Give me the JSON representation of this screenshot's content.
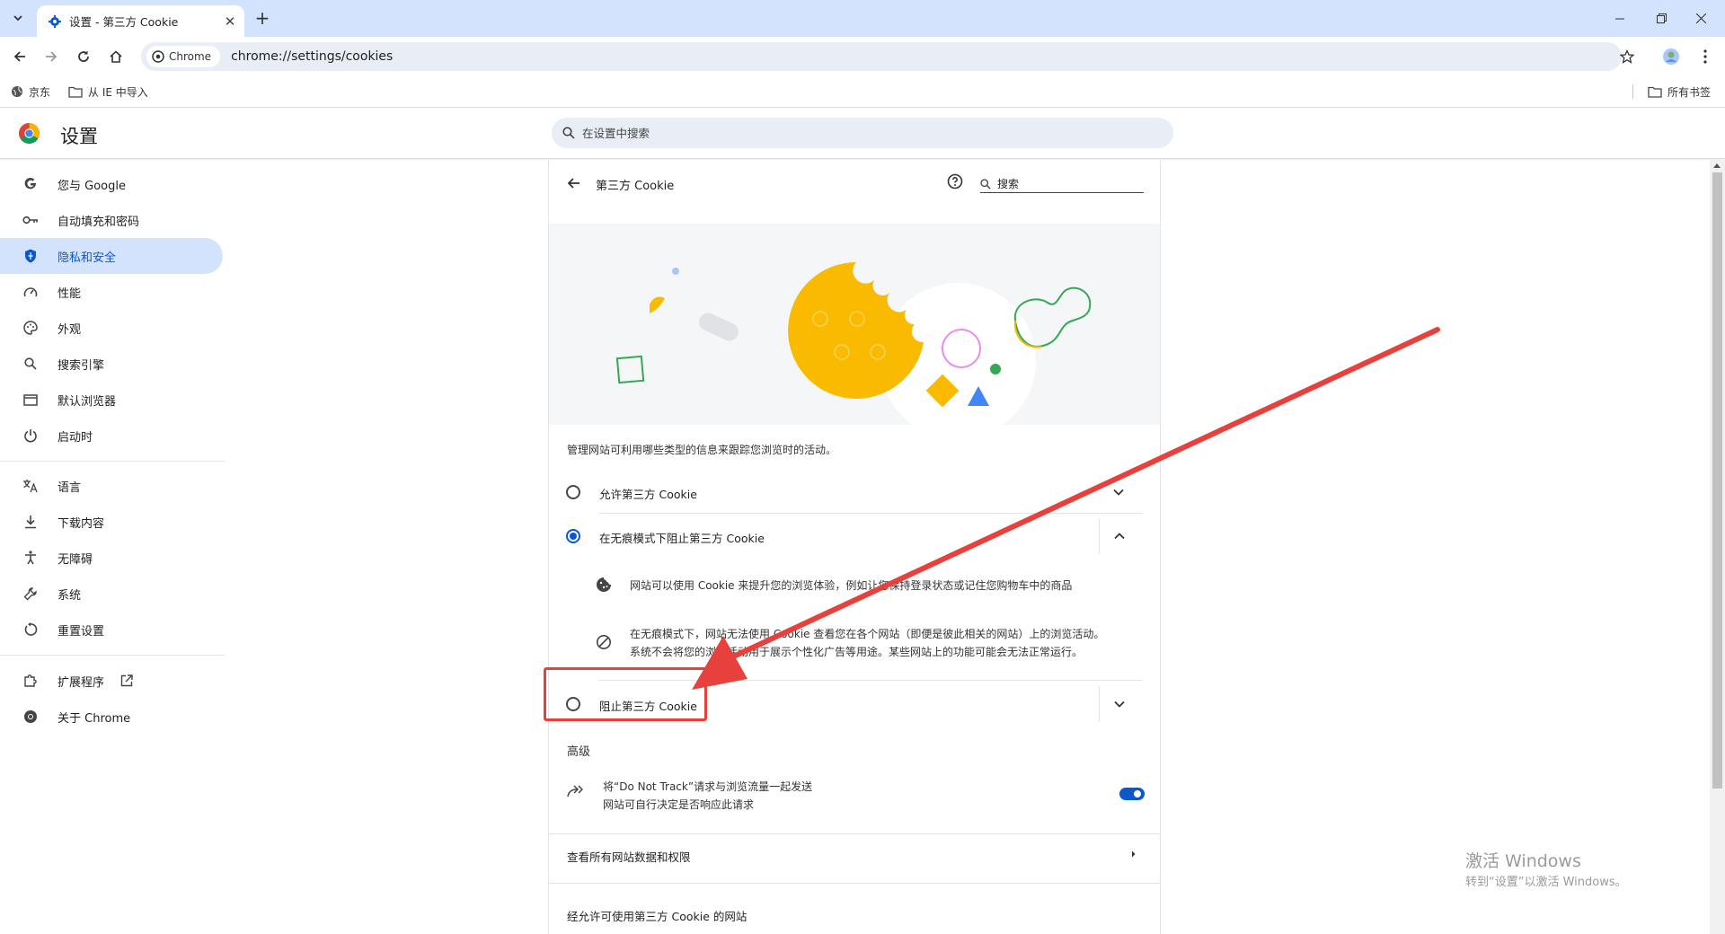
{
  "browser": {
    "tab_title": "设置 - 第三方 Cookie",
    "chip_label": "Chrome",
    "url": "chrome://settings/cookies",
    "bookmarks": [
      "京东",
      "从 IE 中导入"
    ],
    "all_bookmarks": "所有书签"
  },
  "header": {
    "title": "设置",
    "search_placeholder": "在设置中搜索"
  },
  "sidebar": {
    "items": [
      {
        "label": "您与 Google",
        "icon": "google-icon"
      },
      {
        "label": "自动填充和密码",
        "icon": "key-icon"
      },
      {
        "label": "隐私和安全",
        "icon": "shield-icon",
        "active": true
      },
      {
        "label": "性能",
        "icon": "speedometer-icon"
      },
      {
        "label": "外观",
        "icon": "palette-icon"
      },
      {
        "label": "搜索引擎",
        "icon": "search-icon"
      },
      {
        "label": "默认浏览器",
        "icon": "browser-window-icon"
      },
      {
        "label": "启动时",
        "icon": "power-icon"
      },
      {
        "label": "语言",
        "icon": "translate-icon"
      },
      {
        "label": "下载内容",
        "icon": "download-icon"
      },
      {
        "label": "无障碍",
        "icon": "accessibility-icon"
      },
      {
        "label": "系统",
        "icon": "wrench-icon"
      },
      {
        "label": "重置设置",
        "icon": "reset-icon"
      },
      {
        "label": "扩展程序",
        "icon": "puzzle-icon"
      },
      {
        "label": "关于 Chrome",
        "icon": "chrome-icon"
      }
    ]
  },
  "page": {
    "subtitle": "第三方 Cookie",
    "search_label": "搜索",
    "description": "管理网站可利用哪些类型的信息来跟踪您浏览时的活动。",
    "options": [
      {
        "label": "允许第三方 Cookie",
        "selected": false
      },
      {
        "label": "在无痕模式下阻止第三方 Cookie",
        "selected": true
      },
      {
        "label": "阻止第三方 Cookie",
        "selected": false
      }
    ],
    "details": [
      {
        "icon": "cookie-icon",
        "text": "网站可以使用 Cookie 来提升您的浏览体验，例如让您保持登录状态或记住您购物车中的商品"
      },
      {
        "icon": "block-icon",
        "line1": "在无痕模式下，网站无法使用 Cookie 查看您在各个网站（即便是彼此相关的网站）上的浏览活动。",
        "line2": "系统不会将您的浏览活动用于展示个性化广告等用途。某些网站上的功能可能会无法正常运行。"
      }
    ],
    "advanced_title": "高级",
    "dnt_line1": "将“Do Not Track”请求与浏览流量一起发送",
    "dnt_line2": "网站可自行决定是否响应此请求",
    "dnt_enabled": true,
    "site_data_link": "查看所有网站数据和权限",
    "allowed_title": "经允许可使用第三方 Cookie 的网站"
  },
  "watermark": {
    "line1": "激活 Windows",
    "line2": "转到“设置”以激活 Windows。"
  },
  "colors": {
    "accent": "#0b57d0",
    "annotation": "#e8413d",
    "tabstrip": "#d3e3fd"
  }
}
